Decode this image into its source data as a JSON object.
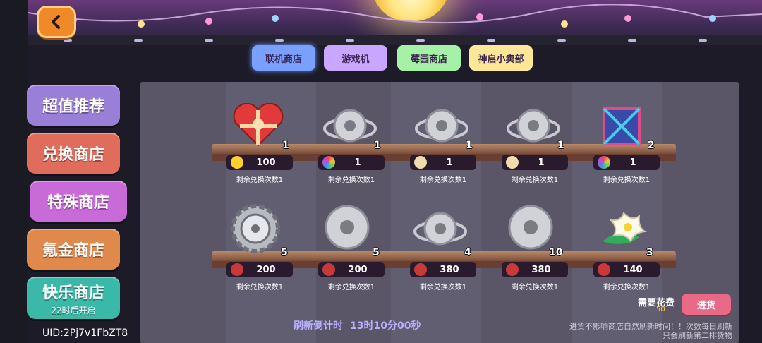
{
  "nav": {
    "back_icon": "chevron-left-icon"
  },
  "tabs": [
    {
      "label": "联机商店",
      "color": "#7aa0ff"
    },
    {
      "label": "游戏机",
      "color": "#c9a6ff"
    },
    {
      "label": "莓园商店",
      "color": "#a7f0a7"
    },
    {
      "label": "神启小卖部",
      "color": "#ffe79a"
    }
  ],
  "sidebar": [
    {
      "label": "超值推荐",
      "sub": "",
      "color": "#9a7fd8"
    },
    {
      "label": "兑换商店",
      "sub": "",
      "color": "#e06c5c"
    },
    {
      "label": "特殊商店",
      "sub": "",
      "color": "#c86ad8"
    },
    {
      "label": "氪金商店",
      "sub": "",
      "color": "#e0894c"
    },
    {
      "label": "快乐商店",
      "sub": "22时后开启",
      "color": "#3ab8a8"
    }
  ],
  "shelf1": [
    {
      "icon": "heart-gift-box-icon",
      "count": "1",
      "price": "100",
      "currency_icon": "star-coin-icon",
      "remain": "剩余兑换次数1"
    },
    {
      "icon": "silver-gear-planet-icon",
      "count": "1",
      "price": "1",
      "currency_icon": "rainbow-gem-icon",
      "remain": "剩余兑换次数1"
    },
    {
      "icon": "silver-gear-planet-icon",
      "count": "1",
      "price": "1",
      "currency_icon": "cupcake-icon",
      "remain": "剩余兑换次数1"
    },
    {
      "icon": "silver-gear-planet-icon",
      "count": "1",
      "price": "1",
      "currency_icon": "cupcake-icon",
      "remain": "剩余兑换次数1"
    },
    {
      "icon": "mystery-cube-icon",
      "count": "2",
      "price": "1",
      "currency_icon": "rainbow-gem-icon",
      "remain": "剩余兑换次数1"
    }
  ],
  "shelf2": [
    {
      "icon": "silver-gear-icon",
      "count": "5",
      "price": "200",
      "currency_icon": "flower-token-icon",
      "remain": "剩余兑换次数1"
    },
    {
      "icon": "silver-gear-planet-icon",
      "count": "5",
      "price": "200",
      "currency_icon": "flower-token-icon",
      "remain": "剩余兑换次数1"
    },
    {
      "icon": "silver-gear-planet-icon",
      "count": "4",
      "price": "380",
      "currency_icon": "flower-token-icon",
      "remain": "剩余兑换次数1"
    },
    {
      "icon": "silver-gear-icon",
      "count": "10",
      "price": "380",
      "currency_icon": "flower-token-icon",
      "remain": "剩余兑换次数1"
    },
    {
      "icon": "white-flower-icon",
      "count": "3",
      "price": "140",
      "currency_icon": "flower-token-icon",
      "remain": "剩余兑换次数1"
    }
  ],
  "footer": {
    "uid": "UID:2Pj7v1FbZT8",
    "countdown_label": "刷新倒计时",
    "countdown_value": "13时10分00秒",
    "need_label": "需要花费",
    "need_value": "50",
    "restock_label": "进货",
    "note_line1": "进货不影响商店自然刷新时间！！次数每日刷新",
    "note_line2": "只会刷新第二排货物"
  }
}
